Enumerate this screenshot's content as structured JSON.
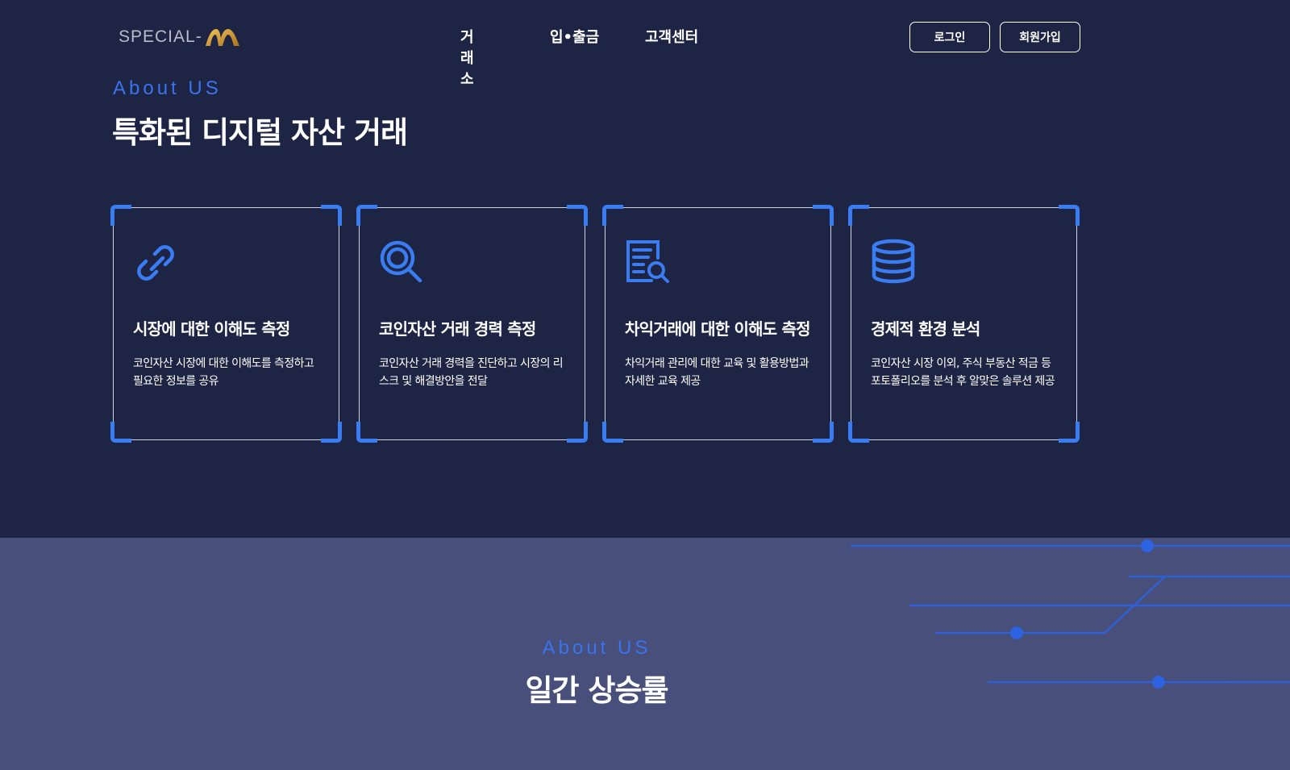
{
  "header": {
    "logo_text": "SPECIAL-",
    "nav": [
      "거래소",
      "입•출금",
      "고객센터"
    ],
    "login_label": "로그인",
    "signup_label": "회원가입"
  },
  "section1": {
    "eyebrow": "About US",
    "title": "특화된 디지털 자산 거래",
    "cards": [
      {
        "icon": "link-icon",
        "title": "시장에 대한 이해도 측정",
        "desc": "코인자산 시장에 대한 이해도를 측정하고 필요한 정보를 공유"
      },
      {
        "icon": "magnifier-icon",
        "title": "코인자산 거래 경력 측정",
        "desc": "코인자산 거래 경력을 진단하고 시장의 리스크 및 해결방안을 전달"
      },
      {
        "icon": "document-search-icon",
        "title": "차익거래에 대한 이해도 측정",
        "desc": "차익거래 관리에 대한 교육 및 활용방법과 자세한 교육 제공"
      },
      {
        "icon": "database-icon",
        "title": "경제적 환경 분석",
        "desc": "코인자산 시장 이외, 주식 부동산 적금 등 포토폴리오를 분석 후 알맞은 솔루션 제공"
      }
    ]
  },
  "section2": {
    "eyebrow": "About US",
    "title": "일간 상승률"
  },
  "colors": {
    "background_dark": "#1e2444",
    "background_light": "#474f7a",
    "accent": "#3a73ee",
    "logo_gold": "#c9952e"
  }
}
